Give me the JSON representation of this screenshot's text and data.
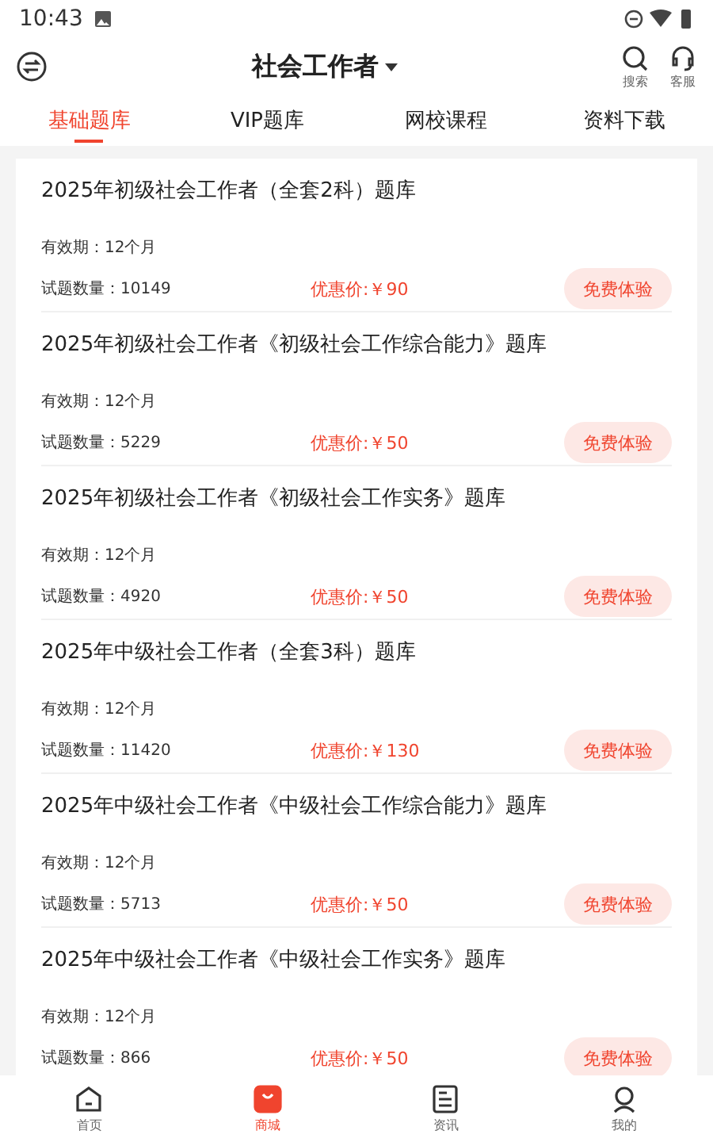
{
  "status_bar": {
    "time": "10:43"
  },
  "header": {
    "title": "社会工作者",
    "actions": [
      {
        "kind": "search",
        "label": "搜索"
      },
      {
        "kind": "service",
        "label": "客服"
      }
    ]
  },
  "tabs": [
    {
      "label": "基础题库",
      "selected": true
    },
    {
      "label": "VIP题库",
      "selected": false
    },
    {
      "label": "网校课程",
      "selected": false
    },
    {
      "label": "资料下载",
      "selected": false
    }
  ],
  "products": [
    {
      "title": "2025年初级社会工作者（全套2科）题库",
      "validity": "有效期：12个月",
      "count": "试题数量：10149",
      "price": "优惠价:￥90",
      "button": "免费体验"
    },
    {
      "title": "2025年初级社会工作者《初级社会工作综合能力》题库",
      "validity": "有效期：12个月",
      "count": "试题数量：5229",
      "price": "优惠价:￥50",
      "button": "免费体验"
    },
    {
      "title": "2025年初级社会工作者《初级社会工作实务》题库",
      "validity": "有效期：12个月",
      "count": "试题数量：4920",
      "price": "优惠价:￥50",
      "button": "免费体验"
    },
    {
      "title": "2025年中级社会工作者（全套3科）题库",
      "validity": "有效期：12个月",
      "count": "试题数量：11420",
      "price": "优惠价:￥130",
      "button": "免费体验"
    },
    {
      "title": "2025年中级社会工作者《中级社会工作综合能力》题库",
      "validity": "有效期：12个月",
      "count": "试题数量：5713",
      "price": "优惠价:￥50",
      "button": "免费体验"
    },
    {
      "title": "2025年中级社会工作者《中级社会工作实务》题库",
      "validity": "有效期：12个月",
      "count": "试题数量：866",
      "price": "优惠价:￥50",
      "button": "免费体验"
    }
  ],
  "bottom_nav": [
    {
      "kind": "home",
      "label": "首页",
      "selected": false
    },
    {
      "kind": "shop",
      "label": "商城",
      "selected": true
    },
    {
      "kind": "news",
      "label": "资讯",
      "selected": false
    },
    {
      "kind": "me",
      "label": "我的",
      "selected": false
    }
  ]
}
